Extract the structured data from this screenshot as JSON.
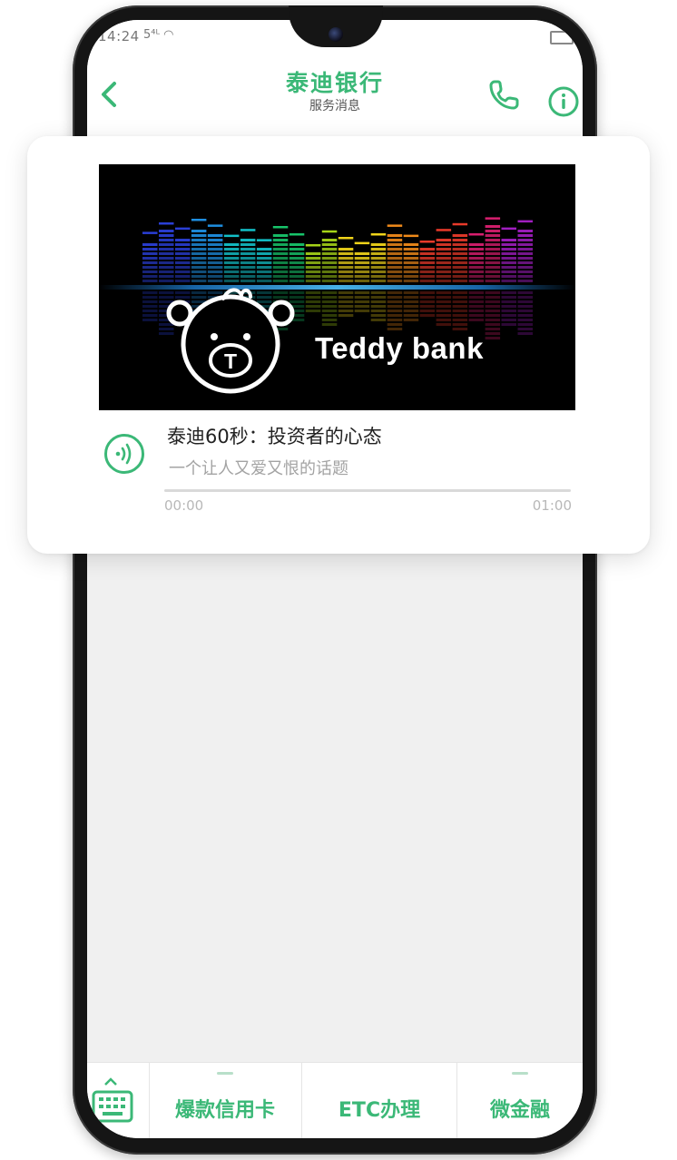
{
  "colors": {
    "accent": "#3bb877",
    "screen_background": "#f0f0f0",
    "card_background": "#ffffff",
    "muted_text": "#a3a3a3",
    "equalizer_spectrum": [
      "#2a3fd6",
      "#1e8ee0",
      "#13c0c8",
      "#17c46a",
      "#a6d418",
      "#f0d41a",
      "#f08a1a",
      "#e83a2a",
      "#d81e6e",
      "#a01ec0"
    ]
  },
  "status_bar": {
    "time": "14:24",
    "signal_icons": "5⁴ᴸ ◠",
    "battery_icon": "battery-icon"
  },
  "header": {
    "title": "泰迪银行",
    "subtitle": "服务消息",
    "back_icon": "chevron-left-icon",
    "phone_icon": "phone-icon",
    "info_icon": "info-icon"
  },
  "message_card": {
    "brand_text": "Teddy bank",
    "logo_letter": "T",
    "audio_title": "泰迪60秒：投资者的心态",
    "audio_subtitle": "一个让人又爱又恨的话题",
    "play_icon": "audio-wave-icon",
    "progress": 0,
    "time_current": "00:00",
    "time_total": "01:00"
  },
  "bottom_menu": {
    "keyboard_icon": "keyboard-icon",
    "items": [
      {
        "label": "爆款信用卡",
        "has_submenu": true
      },
      {
        "label": "ETC办理",
        "has_submenu": false
      },
      {
        "label": "微金融",
        "has_submenu": true
      }
    ]
  }
}
